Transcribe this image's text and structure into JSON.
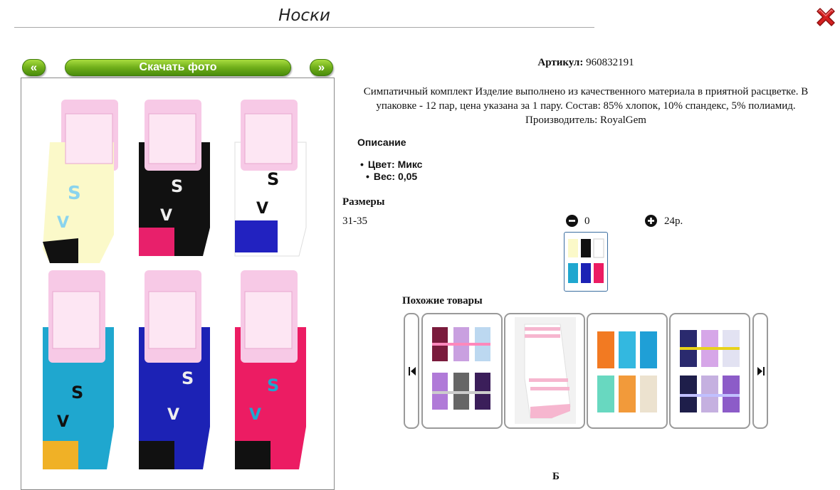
{
  "page": {
    "title": "Носки"
  },
  "gallery": {
    "prev_label": "«",
    "download_label": "Скачать фото",
    "next_label": "»"
  },
  "product": {
    "article_label": "Артикул:",
    "article_value": "960832191",
    "description": "Симпатичный комплект Изделие выполнено из качественного материала в приятной расцветке. В упаковке - 12 пар, цена указана за 1 пару. Состав: 85% хлопок, 10% спандекс, 5% полиамид. Производитель: RoyalGem",
    "section_title": "Описание",
    "attributes": [
      "Цвет: Микс",
      "Вес: 0,05"
    ]
  },
  "sizes": {
    "title": "Размеры",
    "rows": [
      {
        "size": "31-35",
        "quantity": "0",
        "price": "24р."
      }
    ]
  },
  "similar": {
    "title": "Похожие товары"
  },
  "footer": {
    "partial_text": "Б"
  },
  "colors": {
    "accent_green": "#6fae1a",
    "close_red": "#d42020"
  },
  "icons": {
    "close": "close-x-icon",
    "minus": "minus-circle-icon",
    "plus": "plus-circle-icon",
    "first": "first-page-icon",
    "last": "last-page-icon"
  }
}
